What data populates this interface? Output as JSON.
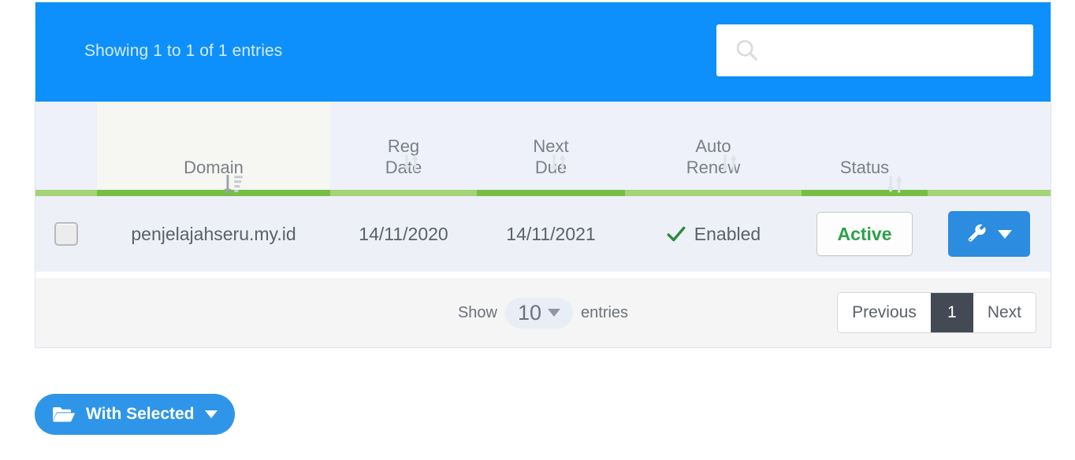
{
  "table": {
    "info_text": "Showing 1 to 1 of 1 entries",
    "search": {
      "value": "",
      "placeholder": ""
    },
    "columns": [
      {
        "key": "select",
        "label": "",
        "sort": "none"
      },
      {
        "key": "domain",
        "label": "Domain",
        "sort": "desc"
      },
      {
        "key": "reg",
        "label": "Reg\nDate",
        "line1": "Reg",
        "line2": "Date",
        "sort": "both"
      },
      {
        "key": "next",
        "label": "Next\nDue",
        "line1": "Next",
        "line2": "Due",
        "sort": "both"
      },
      {
        "key": "auto",
        "label": "Auto\nRenew",
        "line1": "Auto",
        "line2": "Renew",
        "sort": "both"
      },
      {
        "key": "status",
        "label": "Status",
        "line1": "",
        "line2": "Status",
        "sort": "both"
      },
      {
        "key": "actions",
        "label": "",
        "sort": "none"
      }
    ],
    "rows": [
      {
        "checked": false,
        "domain": "penjelajahseru.my.id",
        "reg_date": "14/11/2020",
        "next_due": "14/11/2021",
        "auto_renew": "Enabled",
        "status": "Active",
        "action_label": ""
      }
    ],
    "footer": {
      "show_label": "Show",
      "length_value": "10",
      "entries_label": "entries",
      "pagination": {
        "previous": "Previous",
        "pages": [
          "1"
        ],
        "current": "1",
        "next": "Next"
      }
    }
  },
  "actions": {
    "with_selected_label": "With Selected"
  },
  "colors": {
    "header_blue": "#0d90fb",
    "accent_blue": "#2b8ce0",
    "green_dark": "#76bf43",
    "green_light": "#a5d377",
    "status_green": "#2ca14a",
    "row_bg": "#eef0f8",
    "thead_bg": "#eef1f9",
    "page_active": "#434a54"
  }
}
